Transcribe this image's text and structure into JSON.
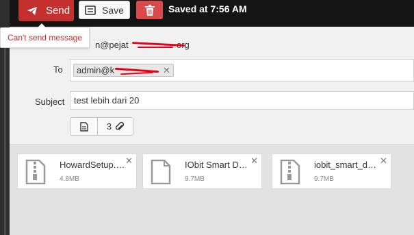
{
  "toolbar": {
    "send_label": "Send",
    "save_label": "Save",
    "saved_status": "Saved at 7:56 AM",
    "send_color": "#c3302d",
    "delete_color": "#d94b4b"
  },
  "tooltip": {
    "text": "Can't send message"
  },
  "form": {
    "from_value": "n@pejat",
    "from_value_tail": "org",
    "to_label": "To",
    "recipient": "admin@k",
    "subject_label": "Subject",
    "subject_value": "test lebih dari 20",
    "attachment_count": "3"
  },
  "attachments": [
    {
      "name": "HowardSetup.zip",
      "size": "4.8MB",
      "icon": "zip-file-icon"
    },
    {
      "name": "IObit Smart Defrag",
      "size": "9.7MB",
      "icon": "file-icon"
    },
    {
      "name": "iobit_smart_defrag",
      "size": "9.7MB",
      "icon": "zip-file-icon"
    }
  ]
}
